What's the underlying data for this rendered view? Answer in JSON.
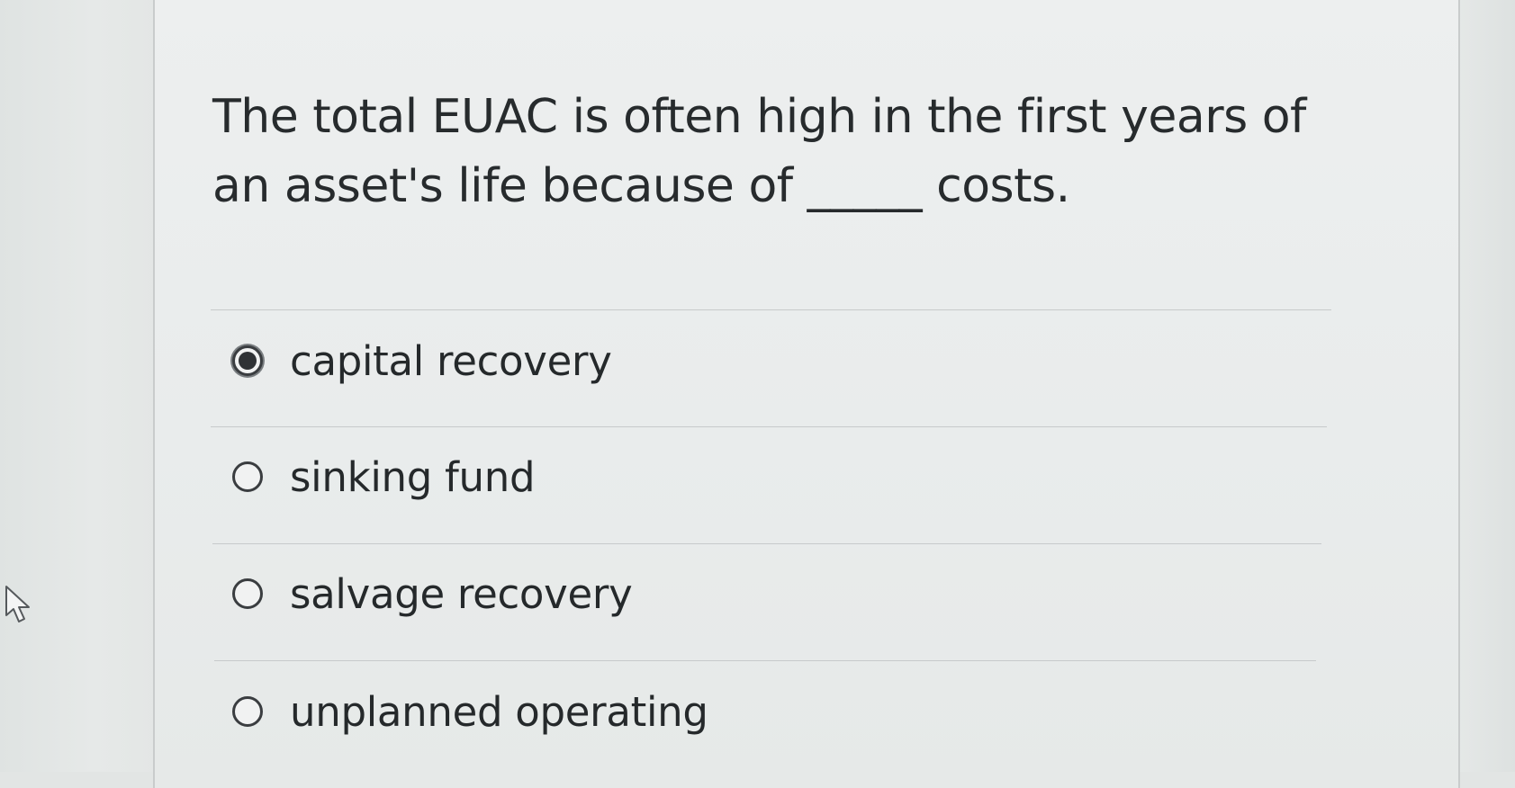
{
  "question": {
    "text": "The total EUAC is often high in the first years of an asset's life because of _____ costs."
  },
  "options": [
    {
      "label": "capital recovery",
      "selected": true
    },
    {
      "label": "sinking fund",
      "selected": false
    },
    {
      "label": "salvage recovery",
      "selected": false
    },
    {
      "label": "unplanned operating",
      "selected": false
    }
  ],
  "icons": {
    "cursor": "mouse-pointer-icon"
  },
  "colors": {
    "text": "#272b2d",
    "panel": "#eceeee",
    "divider": "#c7cacb"
  }
}
